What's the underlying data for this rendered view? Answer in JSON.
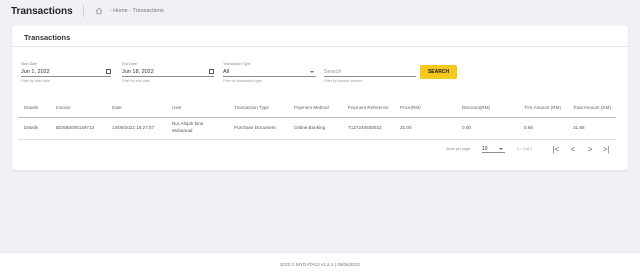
{
  "header": {
    "title": "Transactions",
    "breadcrumb": "- Home - Transactions",
    "home_icon": "home-icon"
  },
  "card": {
    "title": "Transactions"
  },
  "filters": {
    "start_date": {
      "label": "Start Date",
      "value": "Jun 1, 2022",
      "hint": "Filter by start date",
      "icon": "calendar-icon"
    },
    "end_date": {
      "label": "End Date",
      "value": "Jun 18, 2022",
      "hint": "Filter by end date",
      "icon": "calendar-icon"
    },
    "transaction_type": {
      "label": "Transaction Type",
      "value": "All",
      "hint": "Filter by transaction type",
      "icon": "caret-down-icon"
    },
    "search": {
      "placeholder": "Search",
      "hint": "Filter by invoice number"
    },
    "search_button": "SEARCH"
  },
  "table": {
    "columns": [
      "Details",
      "Invoice",
      "Date",
      "User",
      "Transaction Type",
      "Payment Method",
      "Payment Reference",
      "Price(RM)",
      "Discount(RM)",
      "TAX Amount (RM)",
      "Total Amount (RM)"
    ],
    "rows": [
      {
        "details": "Details",
        "invoice": "BDSB0006149713",
        "date": "14/06/2022 16:27:57",
        "user": "Nur Afiqah binti Mohamad",
        "transaction_type": "Purchase Document",
        "payment_method": "Online Banking",
        "payment_reference": "T127240500022",
        "price": "31.00",
        "discount": "0.00",
        "tax": "0.66",
        "total": "31.66"
      }
    ]
  },
  "pager": {
    "items_label": "Items per page:",
    "page_size": "10",
    "range": "1 – 1 of 1",
    "first": "|<",
    "prev": "<",
    "next": ">",
    "last": ">|"
  },
  "footer": {
    "text": "2022 © MYDATA13 v1.2.1  |  09/06/2022"
  }
}
